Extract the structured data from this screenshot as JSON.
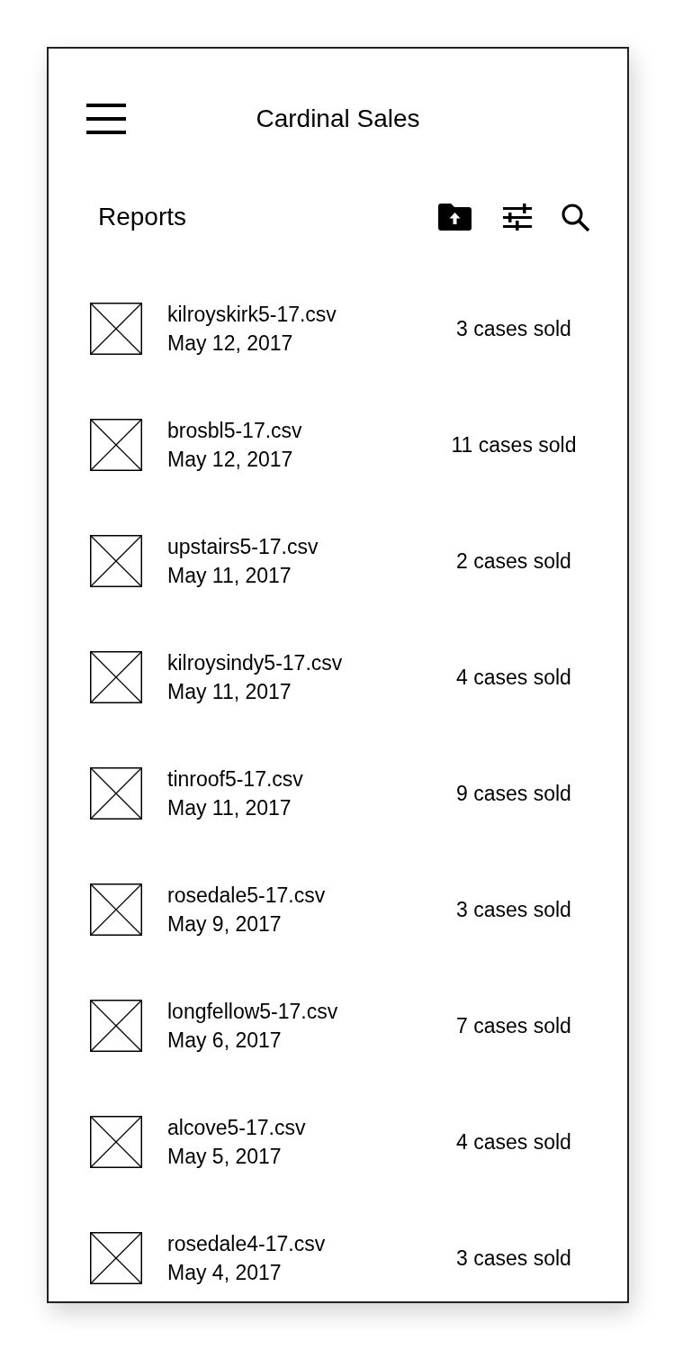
{
  "header": {
    "title": "Cardinal Sales"
  },
  "toolbar": {
    "title": "Reports"
  },
  "reports": [
    {
      "filename": "kilroyskirk5-17.csv",
      "date": "May 12, 2017",
      "sales": "3 cases sold"
    },
    {
      "filename": "brosbl5-17.csv",
      "date": "May 12, 2017",
      "sales": "11 cases sold"
    },
    {
      "filename": "upstairs5-17.csv",
      "date": "May 11, 2017",
      "sales": "2 cases sold"
    },
    {
      "filename": "kilroysindy5-17.csv",
      "date": "May 11, 2017",
      "sales": "4 cases sold"
    },
    {
      "filename": "tinroof5-17.csv",
      "date": "May 11, 2017",
      "sales": "9 cases sold"
    },
    {
      "filename": "rosedale5-17.csv",
      "date": "May 9, 2017",
      "sales": "3 cases sold"
    },
    {
      "filename": "longfellow5-17.csv",
      "date": "May 6, 2017",
      "sales": "7 cases sold"
    },
    {
      "filename": "alcove5-17.csv",
      "date": "May 5, 2017",
      "sales": "4 cases sold"
    },
    {
      "filename": "rosedale4-17.csv",
      "date": "May 4, 2017",
      "sales": "3 cases sold"
    }
  ]
}
